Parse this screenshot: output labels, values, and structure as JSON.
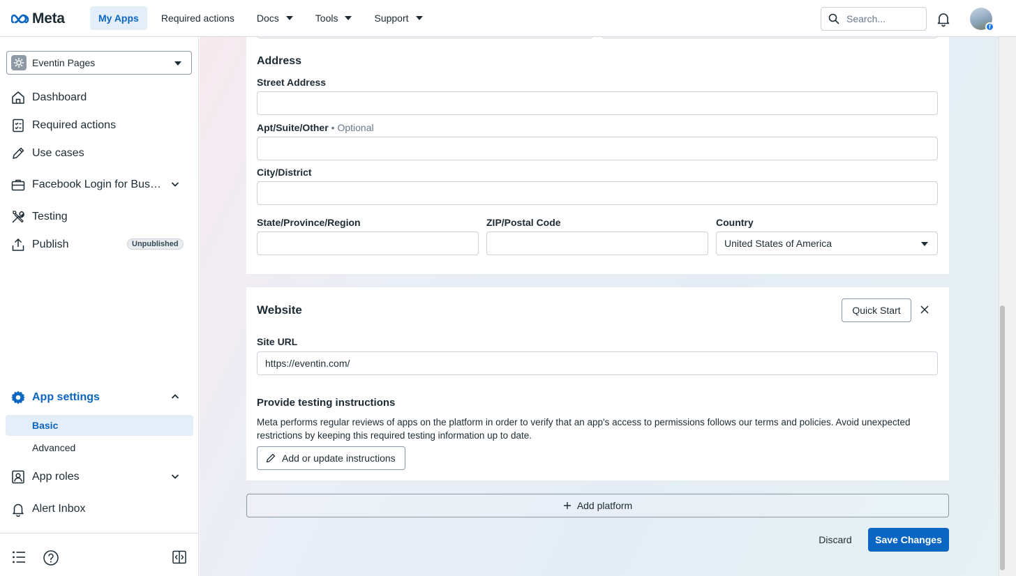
{
  "topbar": {
    "logo_text": "Meta",
    "nav": [
      "My Apps",
      "Required actions",
      "Docs",
      "Tools",
      "Support"
    ],
    "search_placeholder": "Search..."
  },
  "sidebar": {
    "app_name": "Eventin Pages",
    "items": {
      "dashboard": "Dashboard",
      "required_actions": "Required actions",
      "use_cases": "Use cases",
      "facebook_login": "Facebook Login for Bus…",
      "testing": "Testing",
      "publish": "Publish",
      "publish_badge": "Unpublished",
      "app_settings": "App settings",
      "basic": "Basic",
      "advanced": "Advanced",
      "app_roles": "App roles",
      "alert_inbox": "Alert Inbox"
    }
  },
  "address": {
    "title": "Address",
    "street_label": "Street Address",
    "street_value": "",
    "apt_label": "Apt/Suite/Other",
    "apt_optional": "• Optional",
    "city_label": "City/District",
    "state_label": "State/Province/Region",
    "zip_label": "ZIP/Postal Code",
    "country_label": "Country",
    "country_value": "United States of America"
  },
  "website": {
    "title": "Website",
    "quick_start": "Quick Start",
    "site_url_label": "Site URL",
    "site_url_value": "https://eventin.com/",
    "testing_title": "Provide testing instructions",
    "testing_desc": "Meta performs regular reviews of apps on the platform in order to verify that an app's access to permissions follows our terms and policies. Avoid unexpected restrictions by keeping this required testing information up to date.",
    "add_instructions": "Add or update instructions"
  },
  "actions": {
    "add_platform": "Add platform",
    "discard": "Discard",
    "save": "Save Changes"
  },
  "colors": {
    "accent": "#0a66c2",
    "active_bg": "#e3eef8"
  }
}
